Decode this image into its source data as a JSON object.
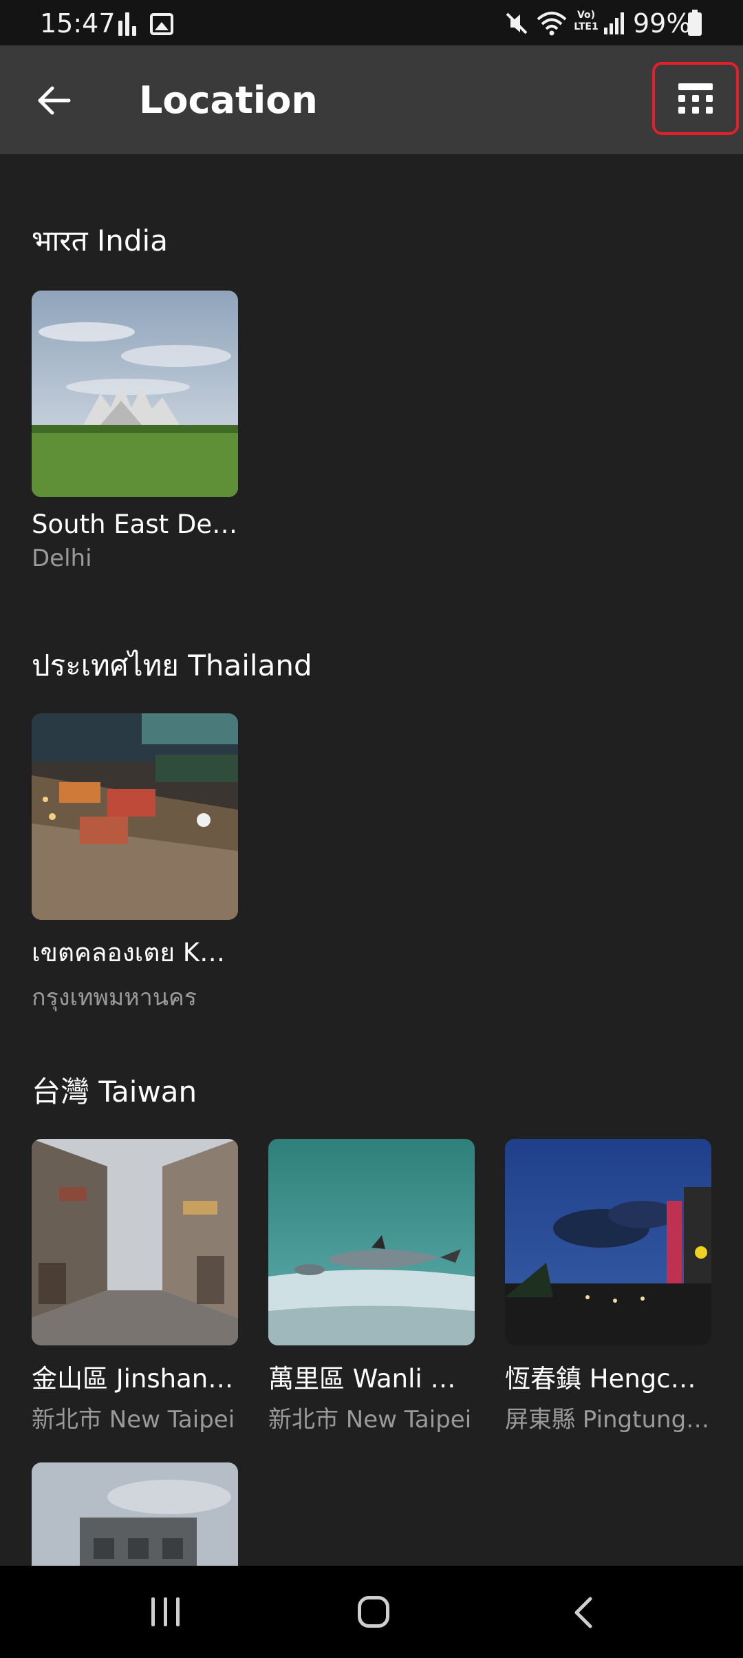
{
  "status_bar": {
    "time": "15:47",
    "battery": "99%",
    "volte": "Vo)\nLTE1",
    "icons": [
      "activity-icon",
      "gallery-icon",
      "mute-icon",
      "wifi-icon",
      "volte-icon",
      "signal-icon",
      "battery-icon"
    ]
  },
  "app_bar": {
    "title": "Location",
    "back_icon": "arrow-left-icon",
    "view_icon": "grid-view-icon",
    "highlight_color": "#e0202a"
  },
  "sections": [
    {
      "title": "भारत India",
      "places": [
        {
          "title": "South East Delhi",
          "subtitle": "Delhi"
        }
      ]
    },
    {
      "title": "ประเทศไทย Thailand",
      "places": [
        {
          "title": "เขตคลองเตย Khlong Toei",
          "subtitle": "กรุงเทพมหานคร"
        }
      ]
    },
    {
      "title": "台灣 Taiwan",
      "places": [
        {
          "title": "金山區 Jinshan District",
          "subtitle": "新北市 New Taipei"
        },
        {
          "title": "萬里區 Wanli District",
          "subtitle": "新北市 New Taipei"
        },
        {
          "title": "恆春鎮 Hengchun",
          "subtitle": "屏東縣 Pingtung County"
        },
        {
          "title": "",
          "subtitle": ""
        }
      ]
    }
  ],
  "nav_bar": {
    "icons": [
      "recent-apps-icon",
      "home-icon",
      "back-icon"
    ]
  },
  "colors": {
    "background": "#202020",
    "app_bar": "#3a3a3a",
    "secondary_text": "#9a9a9a"
  }
}
